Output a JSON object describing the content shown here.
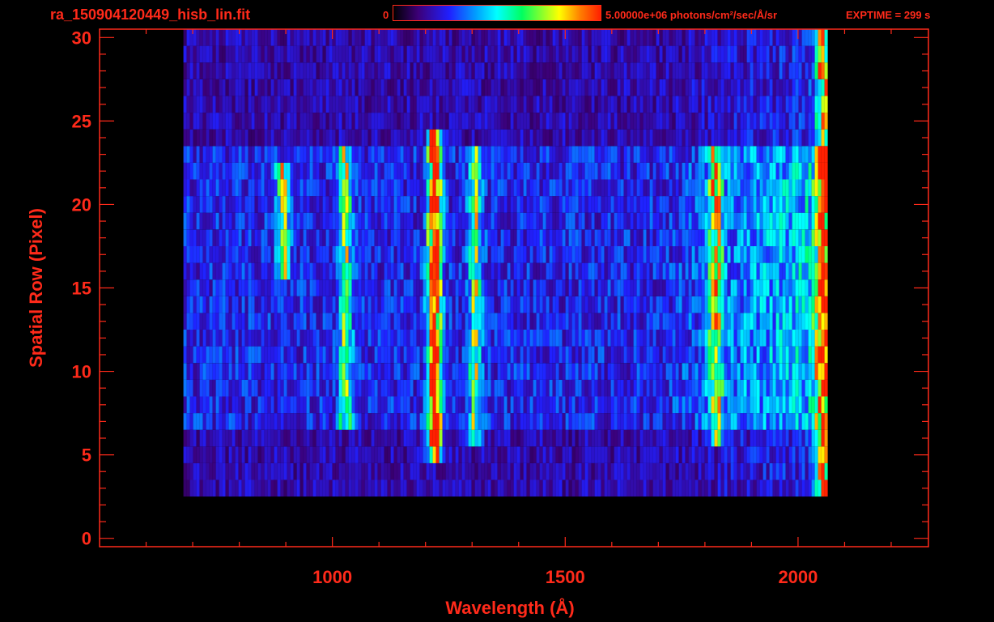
{
  "header": {
    "file_title": "ra_150904120449_hisb_lin.fit",
    "colorbar_min": "0",
    "colorbar_max_label": "5.00000e+06 photons/cm²/sec/Å/sr",
    "exptime_label": "EXPTIME = 299 s"
  },
  "colors": {
    "axis": "#ff2a1a",
    "background": "#000000",
    "colormap": [
      "#000000",
      "#3c0078",
      "#2020ff",
      "#00a0ff",
      "#00ffff",
      "#00ff60",
      "#ffff00",
      "#ff8000",
      "#ff2000"
    ]
  },
  "chart_data": {
    "type": "heatmap",
    "title": "ra_150904120449_hisb_lin.fit",
    "xlabel": "Wavelength (Å)",
    "ylabel": "Spatial Row (Pixel)",
    "xlim": [
      500,
      2280
    ],
    "ylim": [
      -0.5,
      30.5
    ],
    "x_ticks": [
      1000,
      1500,
      2000
    ],
    "y_ticks": [
      0,
      5,
      10,
      15,
      20,
      25,
      30
    ],
    "colorbar": {
      "min": 0,
      "max": 5000000,
      "unit": "photons/cm²/sec/Å/sr",
      "colormap": "rainbow"
    },
    "data_extent": {
      "x": [
        680,
        2060
      ],
      "rows": [
        3,
        30
      ]
    },
    "emission_features": [
      {
        "wavelength": 890,
        "rows": [
          16,
          22
        ],
        "relative_intensity": 0.5
      },
      {
        "wavelength": 1025,
        "rows": [
          7,
          23
        ],
        "relative_intensity": 0.45
      },
      {
        "wavelength": 1216,
        "rows": [
          5,
          24
        ],
        "relative_intensity": 0.95
      },
      {
        "wavelength": 1304,
        "rows": [
          6,
          23
        ],
        "relative_intensity": 0.45
      },
      {
        "wavelength": 1820,
        "rows": [
          6,
          23
        ],
        "relative_intensity": 0.6
      },
      {
        "wavelength": 2050,
        "rows": [
          3,
          30
        ],
        "relative_intensity": 0.7
      }
    ],
    "grid": false
  }
}
